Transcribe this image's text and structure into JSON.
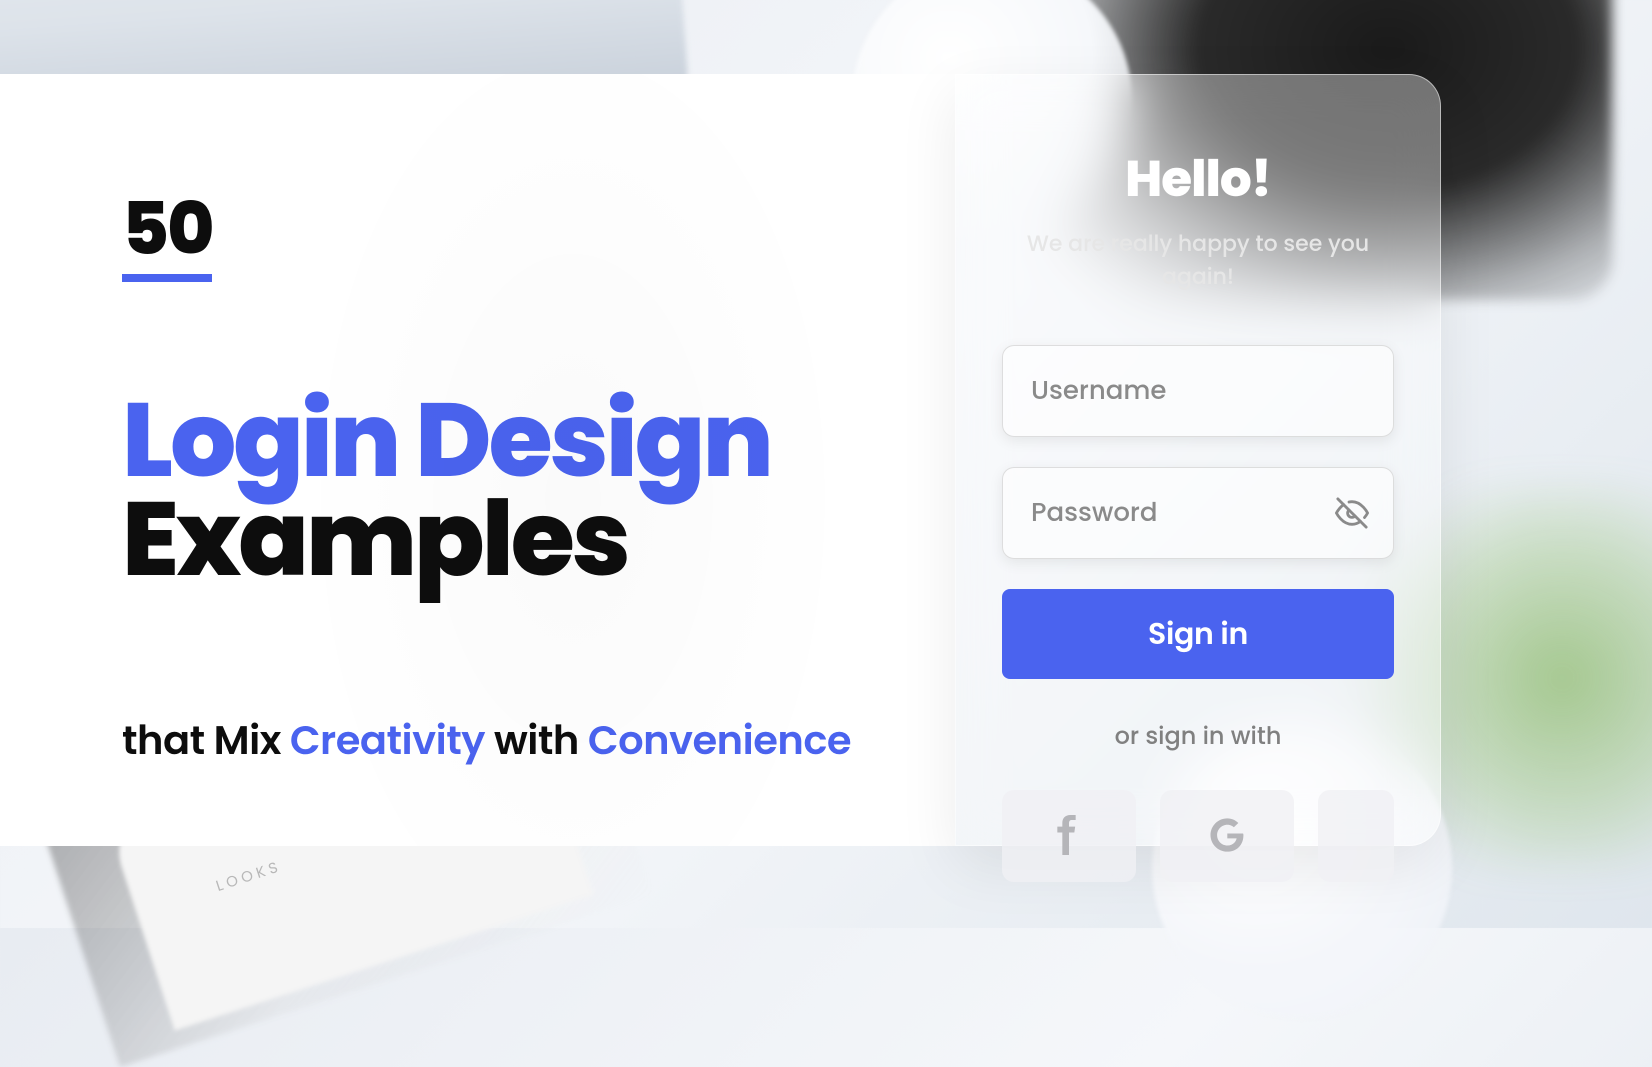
{
  "hero": {
    "number": "50",
    "title_line_1": "Login Design",
    "title_line_2": "Examples",
    "subtitle_pre": "that Mix ",
    "subtitle_word_1": "Creativity",
    "subtitle_mid": " with ",
    "subtitle_word_2": "Convenience"
  },
  "phone_caption": "LOOKS",
  "login": {
    "greeting": "Hello!",
    "subgreeting": "We are really happy to see you again!",
    "username_placeholder": "Username",
    "password_placeholder": "Password",
    "signin_label": "Sign in",
    "or_label": "or sign in with"
  },
  "colors": {
    "accent": "#4a63ef"
  }
}
